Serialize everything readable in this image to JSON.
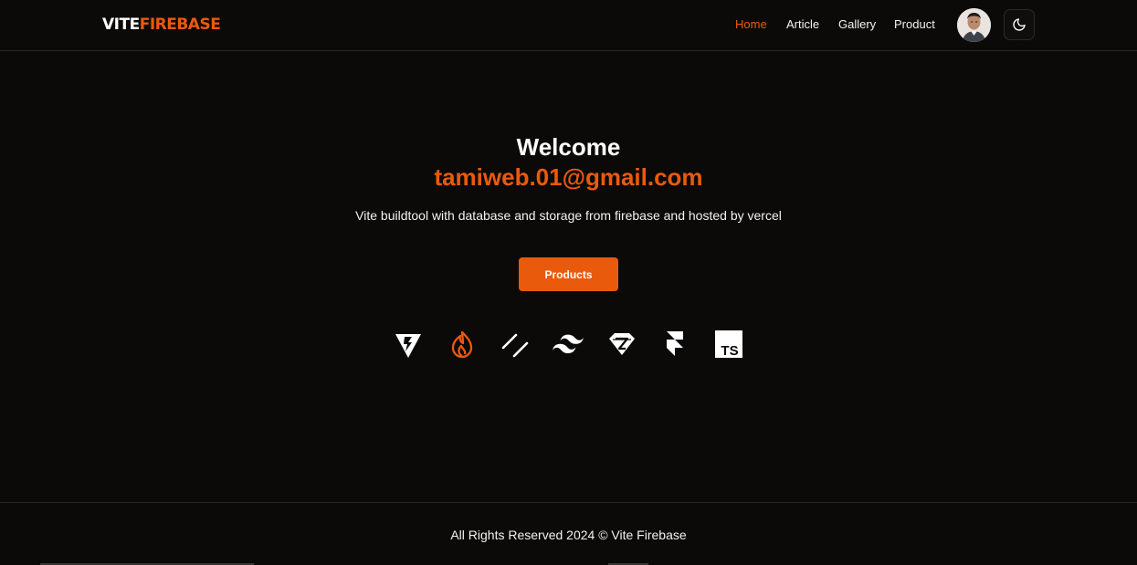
{
  "brand": {
    "part1": "VITE",
    "part2": "FIREBASE"
  },
  "nav": {
    "items": [
      {
        "label": "Home",
        "active": true
      },
      {
        "label": "Article",
        "active": false
      },
      {
        "label": "Gallery",
        "active": false
      },
      {
        "label": "Product",
        "active": false
      }
    ]
  },
  "header": {
    "avatar_icon": "user-avatar",
    "theme_toggle_icon": "moon-icon"
  },
  "hero": {
    "title": "Welcome",
    "email": "tamiweb.01@gmail.com",
    "tagline": "Vite buildtool with database and storage from firebase and hosted by vercel",
    "cta_label": "Products"
  },
  "tech_icons": [
    "vite-icon",
    "firebase-icon",
    "shadcn-icon",
    "tailwind-icon",
    "supabase-icon",
    "framer-icon",
    "typescript-icon"
  ],
  "typescript_badge": "TS",
  "footer": {
    "copyright": "All Rights Reserved 2024 © Vite Firebase"
  },
  "colors": {
    "accent": "#ea5a0c",
    "background": "#0b0a09",
    "text": "#ffffff"
  }
}
